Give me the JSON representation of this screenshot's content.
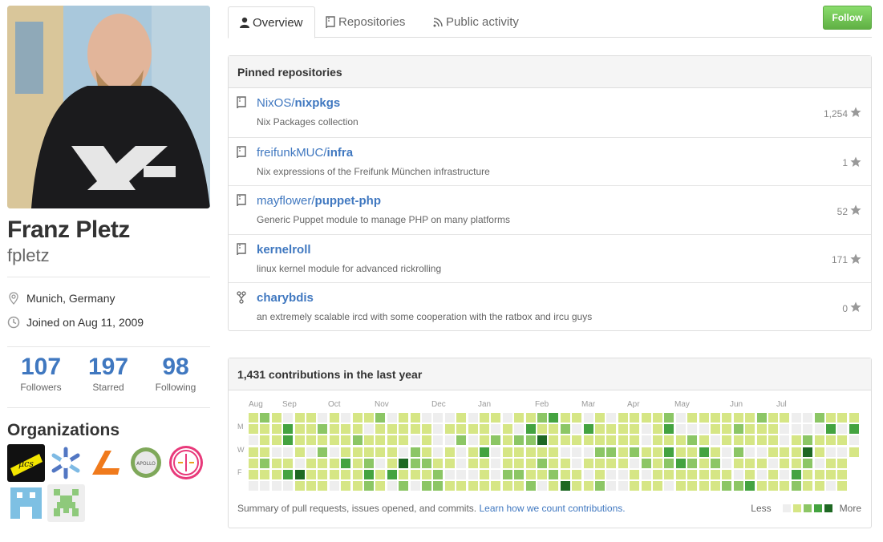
{
  "profile": {
    "fullname": "Franz Pletz",
    "username": "fpletz",
    "location": "Munich, Germany",
    "joined": "Joined on Aug 11, 2009"
  },
  "stats": [
    {
      "num": "107",
      "label": "Followers"
    },
    {
      "num": "197",
      "label": "Starred"
    },
    {
      "num": "98",
      "label": "Following"
    }
  ],
  "orgs_title": "Organizations",
  "orgs": [
    "muccc-org",
    "nixos-org",
    "mayflower-org",
    "apollo-org",
    "munich-org",
    "freifunk-org",
    "space-invader-org"
  ],
  "tabs": {
    "overview": "Overview",
    "repositories": "Repositories",
    "activity": "Public activity"
  },
  "follow_label": "Follow",
  "pinned": {
    "title": "Pinned repositories",
    "repos": [
      {
        "owner": "NixOS/",
        "name": "nixpkgs",
        "desc": "Nix Packages collection",
        "stars": "1,254",
        "icon": "repo-icon"
      },
      {
        "owner": "freifunkMUC/",
        "name": "infra",
        "desc": "Nix expressions of the Freifunk München infrastructure",
        "stars": "1",
        "icon": "repo-icon"
      },
      {
        "owner": "mayflower/",
        "name": "puppet-php",
        "desc": "Generic Puppet module to manage PHP on many platforms",
        "stars": "52",
        "icon": "repo-icon"
      },
      {
        "owner": "",
        "name": "kernelroll",
        "desc": "linux kernel module for advanced rickrolling",
        "stars": "171",
        "icon": "repo-icon"
      },
      {
        "owner": "",
        "name": "charybdis",
        "desc": "an extremely scalable ircd with some cooperation with the ratbox and ircu guys",
        "stars": "0",
        "icon": "fork-icon"
      }
    ]
  },
  "contrib": {
    "title": "1,431 contributions in the last year",
    "months": [
      "Aug",
      "Sep",
      "Oct",
      "Nov",
      "Dec",
      "Jan",
      "Feb",
      "Mar",
      "Apr",
      "May",
      "Jun",
      "Jul"
    ],
    "day_labels": [
      "M",
      "W",
      "F"
    ],
    "summary": "Summary of pull requests, issues opened, and commits.",
    "learn_link": "Learn how we count contributions.",
    "less": "Less",
    "more": "More",
    "colors": [
      "#eeeeee",
      "#d6e685",
      "#8cc665",
      "#44a340",
      "#1e6823"
    ]
  }
}
